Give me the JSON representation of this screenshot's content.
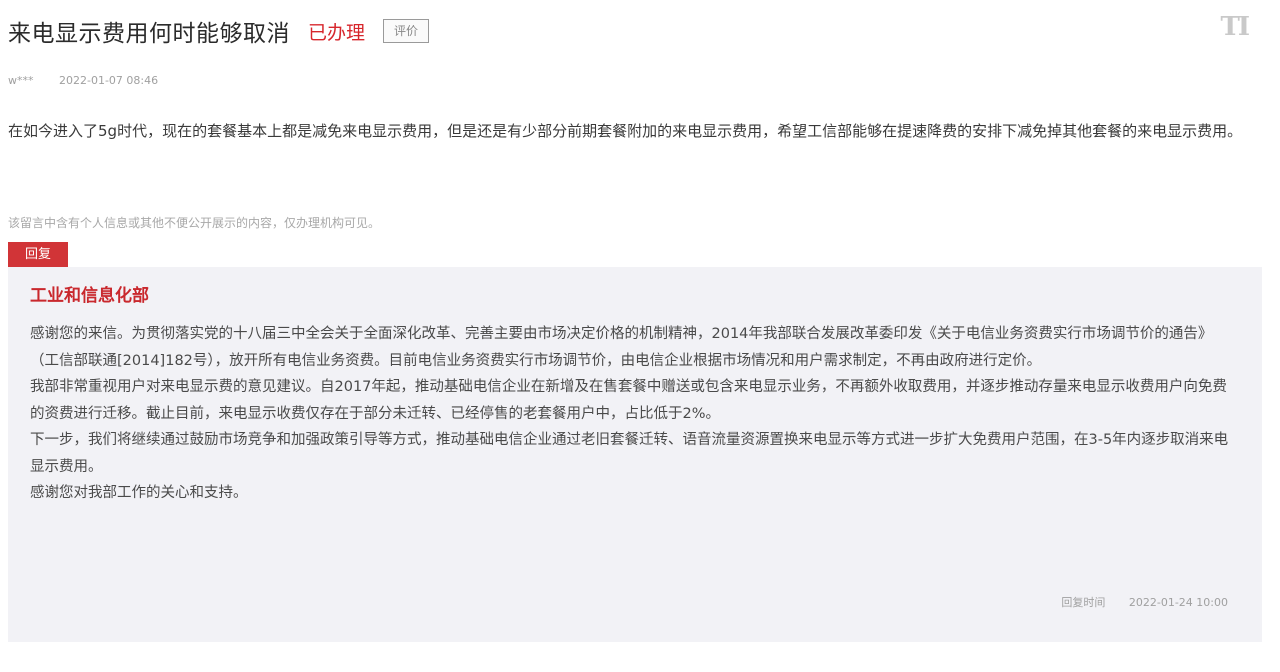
{
  "header": {
    "title": "来电显示费用何时能够取消",
    "status": "已办理",
    "evaluate_label": "评价",
    "brand_mark": "TI"
  },
  "meta": {
    "user": "w***",
    "time": "2022-01-07 08:46"
  },
  "message": {
    "text": "在如今进入了5g时代，现在的套餐基本上都是减免来电显示费用，但是还是有少部分前期套餐附加的来电显示费用，希望工信部能够在提速降费的安排下减免掉其他套餐的来电显示费用。"
  },
  "notice": "该留言中含有个人信息或其他不便公开展示的内容，仅办理机构可见。",
  "reply": {
    "tag": "回复",
    "department": "工业和信息化部",
    "paragraphs": [
      "感谢您的来信。为贯彻落实党的十八届三中全会关于全面深化改革、完善主要由市场决定价格的机制精神，2014年我部联合发展改革委印发《关于电信业务资费实行市场调节价的通告》（工信部联通[2014]182号），放开所有电信业务资费。目前电信业务资费实行市场调节价，由电信企业根据市场情况和用户需求制定，不再由政府进行定价。",
      "我部非常重视用户对来电显示费的意见建议。自2017年起，推动基础电信企业在新增及在售套餐中赠送或包含来电显示业务，不再额外收取费用，并逐步推动存量来电显示收费用户向免费的资费进行迁移。截止目前，来电显示收费仅存在于部分未迁转、已经停售的老套餐用户中，占比低于2%。",
      "下一步，我们将继续通过鼓励市场竞争和加强政策引导等方式，推动基础电信企业通过老旧套餐迁转、语音流量资源置换来电显示等方式进一步扩大免费用户范围，在3-5年内逐步取消来电显示费用。",
      "感谢您对我部工作的关心和支持。"
    ],
    "time_label": "回复时间",
    "time": "2022-01-24 10:00"
  }
}
